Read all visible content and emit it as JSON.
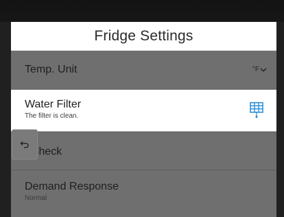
{
  "header": {
    "title": "Fridge Settings"
  },
  "settings": {
    "temp_unit": {
      "label": "Temp. Unit",
      "value": "°F"
    },
    "water_filter": {
      "label": "Water Filter",
      "status": "The filter is clean."
    },
    "self_check": {
      "label": "Self Check",
      "visible_label": "f Check"
    },
    "demand_response": {
      "label": "Demand Response",
      "status": "Normal"
    }
  },
  "icons": {
    "back": "back-arrow-icon",
    "filter": "water-filter-icon",
    "dropdown": "chevron-down-icon"
  },
  "colors": {
    "accent": "#2e8fd6",
    "highlight_row": "#ffffff",
    "dimmed_background": "#6f6f6f"
  }
}
